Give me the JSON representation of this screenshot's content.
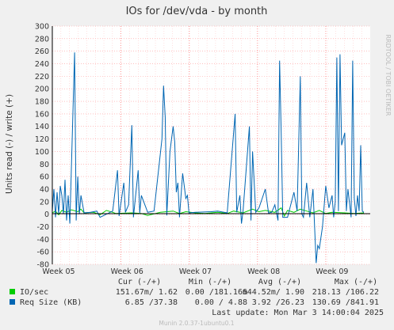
{
  "chart_data": {
    "type": "line",
    "title": "IOs for /dev/vda - by month",
    "ylabel": "Units read (-) / write (+)",
    "xlabel": "",
    "ylim": [
      -80,
      300
    ],
    "yticks": [
      300,
      280,
      260,
      240,
      220,
      200,
      180,
      160,
      140,
      120,
      100,
      80,
      60,
      40,
      20,
      0,
      -20,
      -40,
      -60,
      -80
    ],
    "x_tick_labels": [
      "Week 05",
      "Week 06",
      "Week 07",
      "Week 08",
      "Week 09"
    ],
    "grid": true,
    "series": [
      {
        "name": "IO/sec",
        "color": "#00cc00",
        "points": [
          [
            0.0,
            2
          ],
          [
            0.01,
            5
          ],
          [
            0.02,
            -1
          ],
          [
            0.03,
            6
          ],
          [
            0.045,
            3
          ],
          [
            0.06,
            7
          ],
          [
            0.08,
            4
          ],
          [
            0.09,
            8
          ],
          [
            0.1,
            2
          ],
          [
            0.13,
            3
          ],
          [
            0.15,
            -1
          ],
          [
            0.17,
            6
          ],
          [
            0.19,
            3
          ],
          [
            0.2,
            1
          ],
          [
            0.25,
            2
          ],
          [
            0.28,
            1
          ],
          [
            0.3,
            -2
          ],
          [
            0.34,
            3
          ],
          [
            0.38,
            5
          ],
          [
            0.4,
            1
          ],
          [
            0.42,
            4
          ],
          [
            0.45,
            2
          ],
          [
            0.48,
            1
          ],
          [
            0.52,
            3
          ],
          [
            0.55,
            1
          ],
          [
            0.57,
            5
          ],
          [
            0.6,
            2
          ],
          [
            0.63,
            8
          ],
          [
            0.65,
            4
          ],
          [
            0.67,
            6
          ],
          [
            0.7,
            3
          ],
          [
            0.72,
            10
          ],
          [
            0.73,
            -3
          ],
          [
            0.74,
            6
          ],
          [
            0.76,
            3
          ],
          [
            0.78,
            8
          ],
          [
            0.8,
            5
          ],
          [
            0.82,
            2
          ],
          [
            0.84,
            6
          ],
          [
            0.86,
            1
          ],
          [
            0.88,
            3
          ],
          [
            0.92,
            2
          ],
          [
            0.95,
            1
          ],
          [
            0.98,
            2
          ]
        ]
      },
      {
        "name": "Req Size (KB)",
        "color": "#0066b3",
        "points": [
          [
            0.0,
            5
          ],
          [
            0.005,
            40
          ],
          [
            0.01,
            -5
          ],
          [
            0.015,
            35
          ],
          [
            0.02,
            0
          ],
          [
            0.025,
            45
          ],
          [
            0.03,
            30
          ],
          [
            0.035,
            0
          ],
          [
            0.04,
            55
          ],
          [
            0.045,
            -10
          ],
          [
            0.05,
            30
          ],
          [
            0.055,
            -15
          ],
          [
            0.07,
            258
          ],
          [
            0.075,
            -10
          ],
          [
            0.08,
            60
          ],
          [
            0.085,
            0
          ],
          [
            0.09,
            30
          ],
          [
            0.1,
            2
          ],
          [
            0.12,
            3
          ],
          [
            0.14,
            5
          ],
          [
            0.15,
            -5
          ],
          [
            0.19,
            5
          ],
          [
            0.205,
            70
          ],
          [
            0.21,
            -3
          ],
          [
            0.225,
            50
          ],
          [
            0.23,
            3
          ],
          [
            0.24,
            15
          ],
          [
            0.25,
            142
          ],
          [
            0.255,
            -5
          ],
          [
            0.27,
            70
          ],
          [
            0.275,
            2
          ],
          [
            0.28,
            30
          ],
          [
            0.3,
            3
          ],
          [
            0.32,
            5
          ],
          [
            0.345,
            120
          ],
          [
            0.35,
            205
          ],
          [
            0.355,
            155
          ],
          [
            0.36,
            -2
          ],
          [
            0.37,
            100
          ],
          [
            0.38,
            140
          ],
          [
            0.385,
            115
          ],
          [
            0.39,
            35
          ],
          [
            0.395,
            50
          ],
          [
            0.4,
            -5
          ],
          [
            0.41,
            65
          ],
          [
            0.42,
            25
          ],
          [
            0.425,
            30
          ],
          [
            0.43,
            2
          ],
          [
            0.45,
            3
          ],
          [
            0.5,
            4
          ],
          [
            0.52,
            5
          ],
          [
            0.55,
            2
          ],
          [
            0.575,
            160
          ],
          [
            0.58,
            3
          ],
          [
            0.59,
            30
          ],
          [
            0.595,
            -15
          ],
          [
            0.6,
            5
          ],
          [
            0.62,
            140
          ],
          [
            0.625,
            -10
          ],
          [
            0.63,
            100
          ],
          [
            0.64,
            3
          ],
          [
            0.65,
            10
          ],
          [
            0.67,
            40
          ],
          [
            0.68,
            2
          ],
          [
            0.69,
            3
          ],
          [
            0.7,
            15
          ],
          [
            0.71,
            -10
          ],
          [
            0.715,
            245
          ],
          [
            0.72,
            130
          ],
          [
            0.725,
            -5
          ],
          [
            0.74,
            -5
          ],
          [
            0.76,
            35
          ],
          [
            0.77,
            5
          ],
          [
            0.78,
            220
          ],
          [
            0.785,
            0
          ],
          [
            0.79,
            -5
          ],
          [
            0.8,
            50
          ],
          [
            0.81,
            -5
          ],
          [
            0.82,
            40
          ],
          [
            0.83,
            -78
          ],
          [
            0.835,
            -50
          ],
          [
            0.84,
            -55
          ],
          [
            0.85,
            -20
          ],
          [
            0.86,
            45
          ],
          [
            0.87,
            10
          ],
          [
            0.88,
            30
          ],
          [
            0.885,
            -5
          ],
          [
            0.89,
            20
          ],
          [
            0.895,
            250
          ],
          [
            0.9,
            5
          ],
          [
            0.905,
            255
          ],
          [
            0.91,
            110
          ],
          [
            0.92,
            130
          ],
          [
            0.925,
            5
          ],
          [
            0.93,
            40
          ],
          [
            0.94,
            -5
          ],
          [
            0.945,
            245
          ],
          [
            0.95,
            25
          ],
          [
            0.955,
            -3
          ],
          [
            0.96,
            30
          ],
          [
            0.965,
            5
          ],
          [
            0.97,
            110
          ],
          [
            0.975,
            5
          ],
          [
            0.98,
            3
          ]
        ]
      }
    ],
    "legend": {
      "headers": [
        "Cur (-/+)",
        "Min (-/+)",
        "Avg (-/+)",
        "Max (-/+)"
      ],
      "rows": [
        {
          "name": "IO/sec",
          "color": "#00cc00",
          "cur": "151.67m/ 1.62",
          "min": "0.00 /181.16m",
          "avg": "644.52m/ 1.90",
          "max": "218.13 /106.22"
        },
        {
          "name": "Req Size (KB)",
          "color": "#0066b3",
          "cur": "6.85 /37.38",
          "min": "0.00 / 4.88",
          "avg": "3.92 /26.23",
          "max": "130.69 /841.91"
        }
      ]
    },
    "last_update": "Last update: Mon Mar  3 14:00:04 2025",
    "side_text": "RRDTOOL / TOBI OETIKER",
    "footer": "Munin 2.0.37-1ubuntu0.1"
  }
}
